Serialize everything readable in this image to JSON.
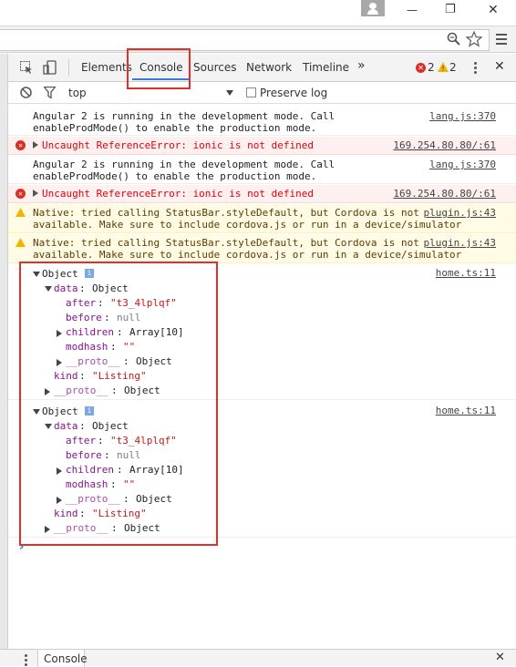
{
  "window": {
    "user_icon": "user-icon",
    "minimize": "—",
    "maximize": "❐",
    "close": "✕"
  },
  "urlbar": {
    "zoom_icon": "zoom-icon",
    "star_icon": "star-icon",
    "menu_icon": "menu-icon"
  },
  "devtools": {
    "tabs": [
      "Elements",
      "Console",
      "Sources",
      "Network",
      "Timeline"
    ],
    "more": "»",
    "error_count": "2",
    "warning_count": "2",
    "close": "✕"
  },
  "filter": {
    "context": "top",
    "preserve_log": "Preserve log"
  },
  "messages": [
    {
      "type": "log",
      "text": "Angular 2 is running in the development mode. Call\nenableProdMode() to enable the production mode.",
      "source": "lang.js:370"
    },
    {
      "type": "error",
      "text": "Uncaught ReferenceError: ionic is not defined",
      "source": "169.254.80.80/:61"
    },
    {
      "type": "log",
      "text": "Angular 2 is running in the development mode. Call\nenableProdMode() to enable the production mode.",
      "source": "lang.js:370"
    },
    {
      "type": "error",
      "text": "Uncaught ReferenceError: ionic is not defined",
      "source": "169.254.80.80/:61"
    },
    {
      "type": "warn",
      "text": "Native: tried calling StatusBar.styleDefault, but Cordova is not\navailable. Make sure to include cordova.js or run in a device/simulator",
      "source": "plugin.js:43"
    },
    {
      "type": "warn",
      "text": "Native: tried calling StatusBar.styleDefault, but Cordova is not\navailable. Make sure to include cordova.js or run in a device/simulator",
      "source": "plugin.js:43"
    }
  ],
  "objects": [
    {
      "source": "home.ts:11",
      "label": "Object",
      "data_key": "data",
      "data_val": "Object",
      "after_key": "after",
      "after_val": "\"t3_4lplqf\"",
      "before_key": "before",
      "before_val": "null",
      "children_key": "children",
      "children_val": "Array[10]",
      "modhash_key": "modhash",
      "modhash_val": "\"\"",
      "proto_key": "__proto__",
      "proto_val": "Object",
      "kind_key": "kind",
      "kind_val": "\"Listing\""
    },
    {
      "source": "home.ts:11",
      "label": "Object",
      "data_key": "data",
      "data_val": "Object",
      "after_key": "after",
      "after_val": "\"t3_4lplqf\"",
      "before_key": "before",
      "before_val": "null",
      "children_key": "children",
      "children_val": "Array[10]",
      "modhash_key": "modhash",
      "modhash_val": "\"\"",
      "proto_key": "__proto__",
      "proto_val": "Object",
      "kind_key": "kind",
      "kind_val": "\"Listing\""
    }
  ],
  "prompt": "›",
  "bottom": {
    "drawer_tab": "Console",
    "close": "✕"
  }
}
